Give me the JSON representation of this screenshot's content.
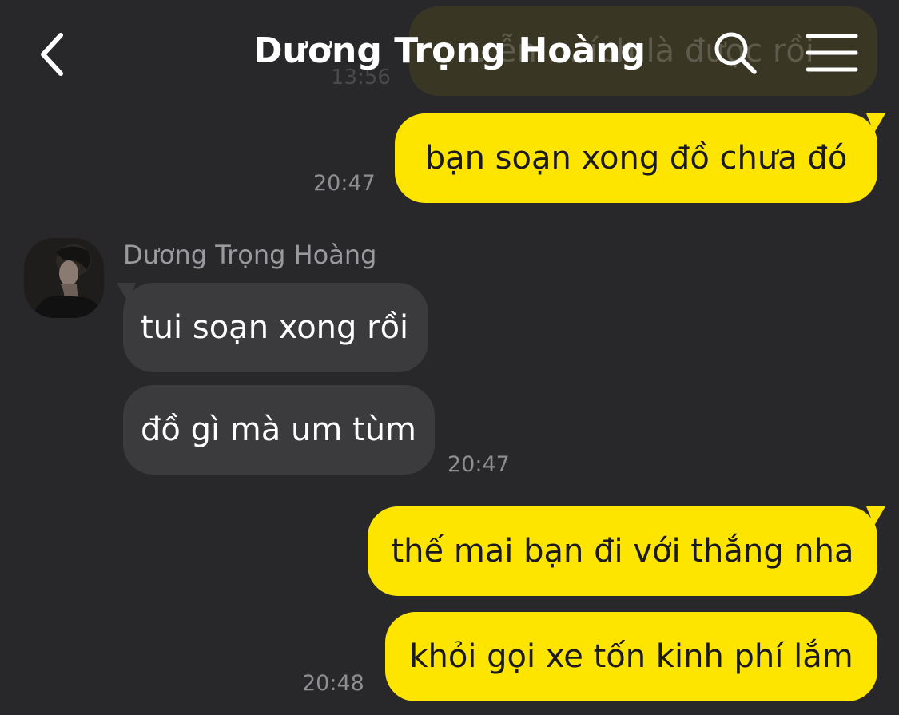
{
  "header": {
    "title": "Dương Trọng Hoàng",
    "back_icon": "chevron-left-icon",
    "search_icon": "search-icon",
    "menu_icon": "menu-icon"
  },
  "messages": {
    "faded_text": "…ễn … ích là được rồi",
    "faded_time": "13:56",
    "out_1": "bạn soạn xong đồ chưa đó",
    "out_1_time": "20:47",
    "sender_name": "Dương Trọng Hoàng",
    "in_1": "tui soạn xong rồi",
    "in_2": "đồ gì mà um tùm",
    "in_time": "20:47",
    "out_2": "thế mai bạn đi với thắng nha",
    "out_3": "khỏi gọi xe tốn kinh phí lắm",
    "out_3_time": "20:48"
  },
  "colors": {
    "background": "#28282b",
    "outgoing_bubble": "#fde500",
    "incoming_bubble": "#3b3b3e",
    "timestamp": "#8e8e92"
  }
}
